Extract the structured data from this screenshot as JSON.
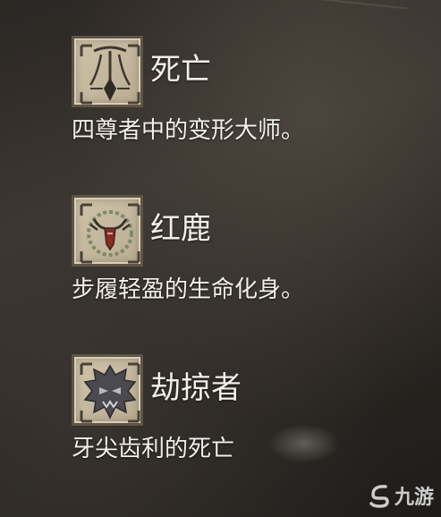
{
  "entries": [
    {
      "icon": "death-sigil-icon",
      "name": "死亡",
      "description": "四尊者中的变形大师。"
    },
    {
      "icon": "red-deer-sigil-icon",
      "name": "红鹿",
      "description": "步履轻盈的生命化身。"
    },
    {
      "icon": "marauder-sigil-icon",
      "name": "劫掠者",
      "description": "牙尖齿利的死亡"
    }
  ],
  "watermark": {
    "icon": "jiuyou-logo-icon",
    "text": "九游"
  }
}
